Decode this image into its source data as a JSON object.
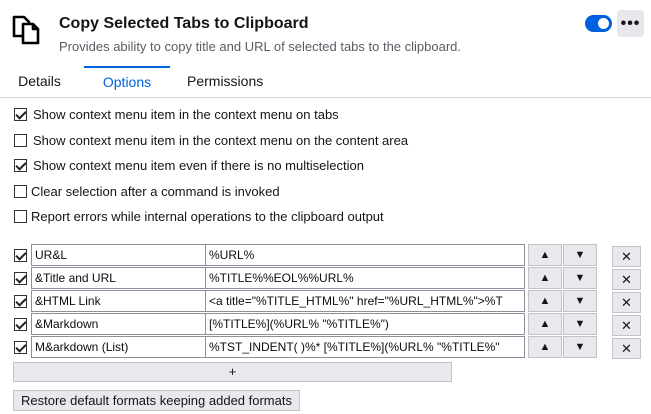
{
  "extension": {
    "icon": "copy-documents-icon",
    "title": "Copy Selected Tabs to Clipboard",
    "description": "Provides ability to copy title and URL of selected tabs to the clipboard.",
    "enabled": true,
    "more_label": "•••",
    "accent_color": "#0061e0"
  },
  "tabs": [
    {
      "label": "Details",
      "active": false
    },
    {
      "label": "Options",
      "active": true
    },
    {
      "label": "Permissions",
      "active": false
    }
  ],
  "options": [
    {
      "label": "Show context menu item in the context menu on tabs",
      "checked": true
    },
    {
      "label": "Show context menu item in the context menu on the content area",
      "checked": false
    },
    {
      "label": "Show context menu item even if there is no multiselection",
      "checked": true
    },
    {
      "label": "Clear selection after a command is invoked",
      "checked": false
    },
    {
      "label": "Report errors while internal operations to the clipboard output",
      "checked": false
    }
  ],
  "formats": [
    {
      "checked": true,
      "name": "UR&L",
      "format": "%URL%"
    },
    {
      "checked": true,
      "name": "&Title and URL",
      "format": "%TITLE%%EOL%%URL%"
    },
    {
      "checked": true,
      "name": "&HTML Link",
      "format": "<a title=\"%TITLE_HTML%\" href=\"%URL_HTML%\">%T"
    },
    {
      "checked": true,
      "name": "&Markdown",
      "format": "[%TITLE%](%URL% \"%TITLE%\")"
    },
    {
      "checked": true,
      "name": "M&arkdown (List)",
      "format": "%TST_INDENT(  )%* [%TITLE%](%URL% \"%TITLE%\""
    }
  ],
  "row_buttons": {
    "up": "▲",
    "down": "▼",
    "delete": "✕"
  },
  "add_label": "+",
  "restore_label": "Restore default formats keeping added formats"
}
